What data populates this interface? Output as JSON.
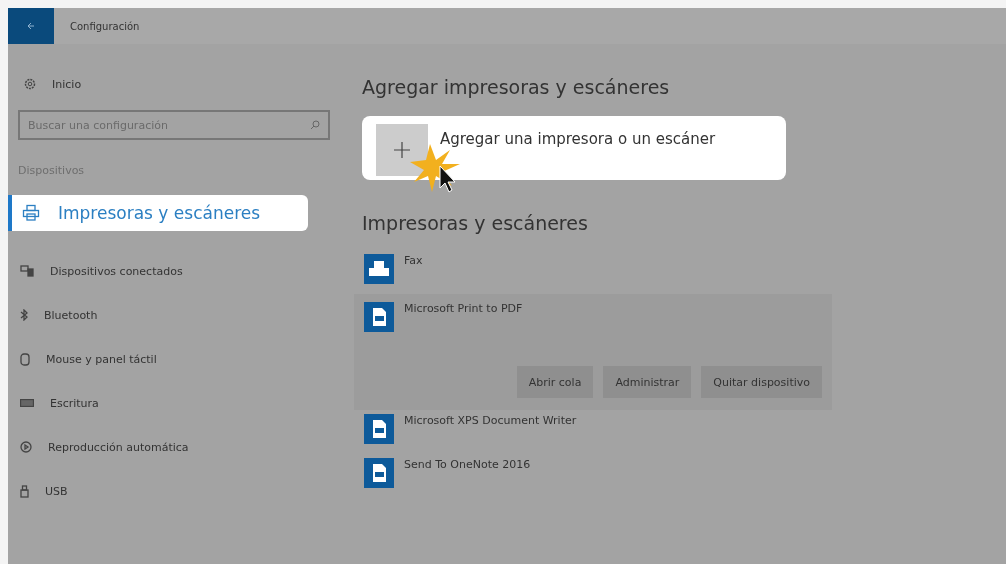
{
  "window": {
    "title": "Configuración"
  },
  "sidebar": {
    "home": "Inicio",
    "search": {
      "placeholder": "Buscar una configuración"
    },
    "section": "Dispositivos",
    "items": [
      {
        "label": "Impresoras y escáneres",
        "selected": true
      },
      {
        "label": "Dispositivos conectados",
        "selected": false
      },
      {
        "label": "Bluetooth",
        "selected": false
      },
      {
        "label": "Mouse y panel táctil",
        "selected": false
      },
      {
        "label": "Escritura",
        "selected": false
      },
      {
        "label": "Reproducción automática",
        "selected": false
      },
      {
        "label": "USB",
        "selected": false
      }
    ]
  },
  "content": {
    "add_heading": "Agregar impresoras y escáneres",
    "add_button": "Agregar una impresora o un escáner",
    "list_heading": "Impresoras y escáneres",
    "printers": [
      {
        "name": "Fax",
        "kind": "fax",
        "selected": false
      },
      {
        "name": "Microsoft Print to PDF",
        "kind": "document",
        "selected": true,
        "actions": [
          "Abrir cola",
          "Administrar",
          "Quitar dispositivo"
        ]
      },
      {
        "name": "Microsoft XPS Document Writer",
        "kind": "document",
        "selected": false
      },
      {
        "name": "Send To OneNote 2016",
        "kind": "document",
        "selected": false
      }
    ]
  }
}
